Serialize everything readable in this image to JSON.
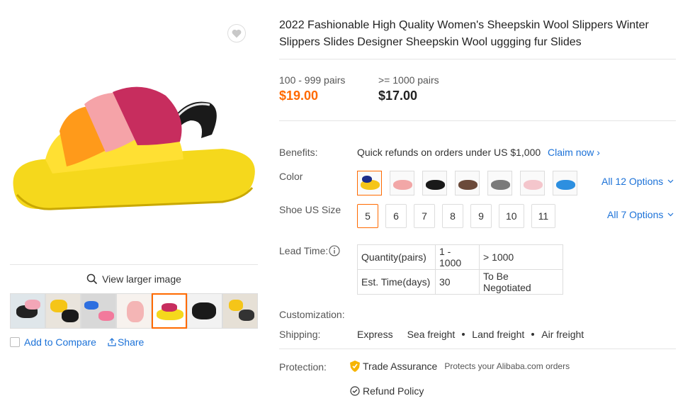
{
  "gallery": {
    "view_larger": "View larger image",
    "add_to_compare": "Add to Compare",
    "share": "Share",
    "thumb_count": 7,
    "active_thumb": 4
  },
  "product": {
    "title": "2022 Fashionable High Quality Women's Sheepskin Wool Slippers Winter Slippers Slides Designer Sheepskin Wool uggging fur Slides"
  },
  "prices": [
    {
      "range": "100 - 999 pairs",
      "price": "$19.00",
      "color": "#ff6a00"
    },
    {
      "range": ">= 1000 pairs",
      "price": "$17.00",
      "color": "#222222"
    }
  ],
  "benefits": {
    "label": "Benefits:",
    "text": "Quick refunds on orders under US $1,000",
    "claim": "Claim now"
  },
  "color": {
    "label": "Color",
    "all_options": "All 12 Options",
    "swatches": [
      "#f5c518",
      "#f2a7a7",
      "#1a1a1a",
      "#6b4a3a",
      "#7a7a7a",
      "#f4c6cc",
      "#2d8fe0"
    ],
    "selected_index": 0
  },
  "size": {
    "label": "Shoe US Size",
    "options": [
      "5",
      "6",
      "7",
      "8",
      "9",
      "10",
      "11"
    ],
    "selected": "5",
    "all_options": "All 7 Options"
  },
  "lead_time": {
    "label": "Lead Time:",
    "row1": [
      "Quantity(pairs)",
      "1 - 1000",
      "> 1000"
    ],
    "row2": [
      "Est. Time(days)",
      "30",
      "To Be Negotiated"
    ]
  },
  "customization": {
    "label": "Customization:"
  },
  "shipping": {
    "label": "Shipping:",
    "methods": [
      "Express",
      "Sea freight",
      "Land freight",
      "Air freight"
    ]
  },
  "protection": {
    "label": "Protection:",
    "trade": "Trade Assurance",
    "trade_note": "Protects your Alibaba.com orders",
    "refund": "Refund Policy"
  },
  "colors": {
    "accent": "#ff6a00",
    "link": "#1c72d8"
  }
}
